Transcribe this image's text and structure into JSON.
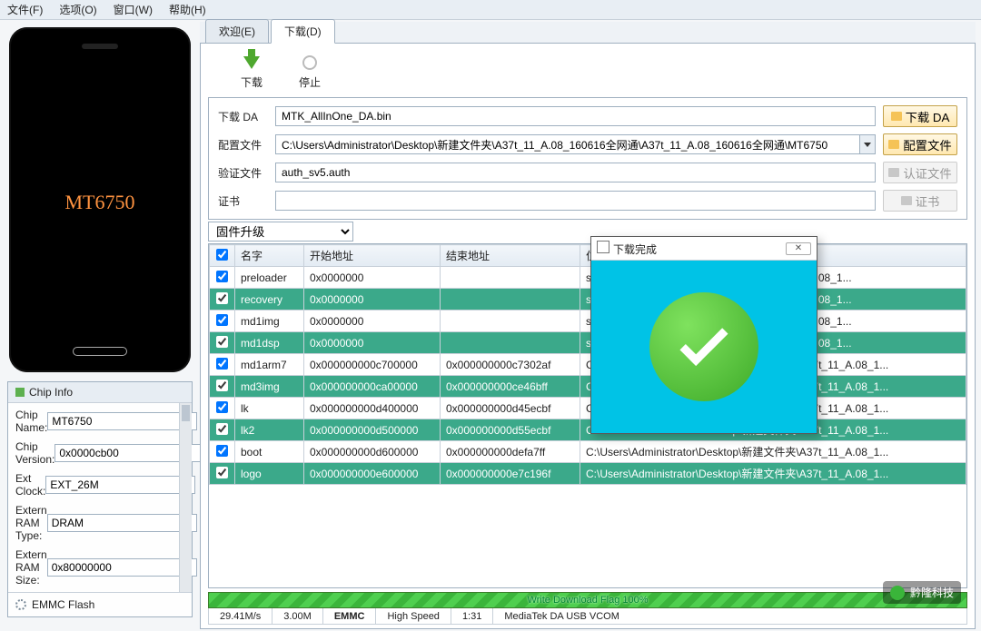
{
  "menu": {
    "file": "文件(F)",
    "options": "选项(O)",
    "window": "窗口(W)",
    "help": "帮助(H)"
  },
  "phone": {
    "chip_label": "MT6750"
  },
  "chipinfo": {
    "title": "Chip Info",
    "rows": {
      "name_label": "Chip Name:",
      "name_val": "MT6750",
      "ver_label": "Chip Version:",
      "ver_val": "0x0000cb00",
      "ext_label": "Ext Clock:",
      "ext_val": "EXT_26M",
      "ram_type_label": "Extern RAM Type:",
      "ram_type_val": "DRAM",
      "ram_size_label": "Extern RAM Size:",
      "ram_size_val": "0x80000000"
    },
    "emmc": "EMMC Flash"
  },
  "tabs": {
    "welcome": "欢迎(E)",
    "download": "下载(D)"
  },
  "topbtns": {
    "download": "下载",
    "stop": "停止"
  },
  "form": {
    "da_label": "下载 DA",
    "da_val": "MTK_AllInOne_DA.bin",
    "da_btn": "下载 DA",
    "cfg_label": "配置文件",
    "cfg_val": "C:\\Users\\Administrator\\Desktop\\新建文件夹\\A37t_11_A.08_160616全网通\\A37t_11_A.08_160616全网通\\MT6750",
    "cfg_btn": "配置文件",
    "auth_label": "验证文件",
    "auth_val": "auth_sv5.auth",
    "auth_btn": "认证文件",
    "cert_label": "证书",
    "cert_val": "",
    "cert_btn": "证书"
  },
  "firmware": {
    "mode": "固件升级"
  },
  "table": {
    "headers": {
      "name": "名字",
      "start": "开始地址",
      "end": "结束地址",
      "loc": "位置"
    },
    "rows": [
      {
        "done": false,
        "name": "preloader",
        "start": "0x0000000",
        "end": "",
        "loc": "s\\Administrator\\Desktop\\新建文件夹\\A37t_11_A.08_1..."
      },
      {
        "done": true,
        "name": "recovery",
        "start": "0x0000000",
        "end": "",
        "loc": "s\\Administrator\\Desktop\\新建文件夹\\A37t_11_A.08_1..."
      },
      {
        "done": false,
        "name": "md1img",
        "start": "0x0000000",
        "end": "",
        "loc": "s\\Administrator\\Desktop\\新建文件夹\\A37t_11_A.08_1..."
      },
      {
        "done": true,
        "name": "md1dsp",
        "start": "0x0000000",
        "end": "",
        "loc": "s\\Administrator\\Desktop\\新建文件夹\\A37t_11_A.08_1..."
      },
      {
        "done": false,
        "name": "md1arm7",
        "start": "0x000000000c700000",
        "end": "0x000000000c7302af",
        "loc": "C:\\Users\\Administrator\\Desktop\\新建文件夹\\A37t_11_A.08_1..."
      },
      {
        "done": true,
        "name": "md3img",
        "start": "0x000000000ca00000",
        "end": "0x000000000ce46bff",
        "loc": "C:\\Users\\Administrator\\Desktop\\新建文件夹\\A37t_11_A.08_1..."
      },
      {
        "done": false,
        "name": "lk",
        "start": "0x000000000d400000",
        "end": "0x000000000d45ecbf",
        "loc": "C:\\Users\\Administrator\\Desktop\\新建文件夹\\A37t_11_A.08_1..."
      },
      {
        "done": true,
        "name": "lk2",
        "start": "0x000000000d500000",
        "end": "0x000000000d55ecbf",
        "loc": "C:\\Users\\Administrator\\Desktop\\新建文件夹\\A37t_11_A.08_1..."
      },
      {
        "done": false,
        "name": "boot",
        "start": "0x000000000d600000",
        "end": "0x000000000defa7ff",
        "loc": "C:\\Users\\Administrator\\Desktop\\新建文件夹\\A37t_11_A.08_1..."
      },
      {
        "done": true,
        "name": "logo",
        "start": "0x000000000e600000",
        "end": "0x000000000e7c196f",
        "loc": "C:\\Users\\Administrator\\Desktop\\新建文件夹\\A37t_11_A.08_1..."
      }
    ]
  },
  "status": {
    "progress_text": "Write Download Flag 100%",
    "speed": "29.41M/s",
    "size": "3.00M",
    "storage": "EMMC",
    "mode": "High Speed",
    "elapsed": "1:31",
    "port": "MediaTek DA USB VCOM"
  },
  "modal": {
    "title": "下载完成"
  },
  "wechat": {
    "label": "黔隆科技"
  }
}
